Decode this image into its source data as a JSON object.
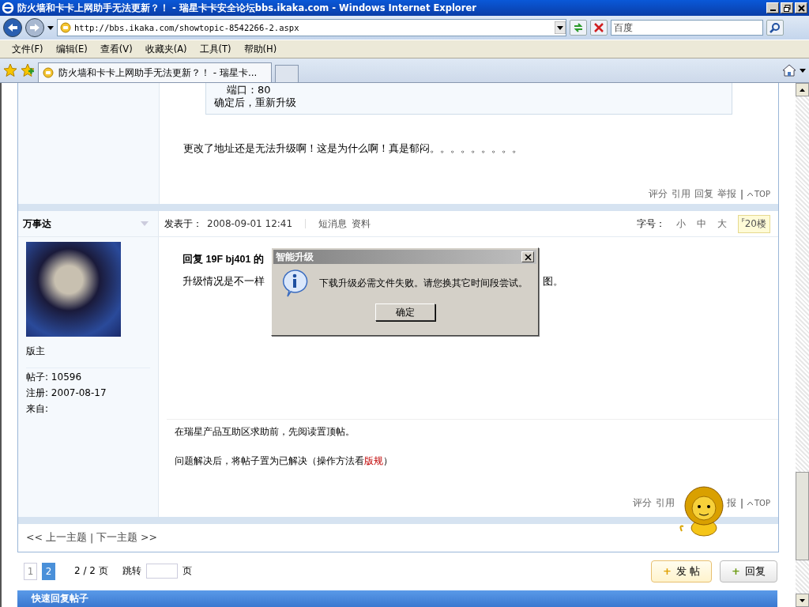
{
  "window": {
    "title": "防火墙和卡卡上网助手无法更新？！ - 瑞星卡卡安全论坛bbs.ikaka.com - Windows Internet Explorer"
  },
  "address_bar": {
    "url": "http://bbs.ikaka.com/showtopic-8542266-2.aspx",
    "search_placeholder": "百度"
  },
  "menu": [
    "文件(F)",
    "编辑(E)",
    "查看(V)",
    "收藏夹(A)",
    "工具(T)",
    "帮助(H)"
  ],
  "tabs": [
    {
      "label": "防火墙和卡卡上网助手无法更新？！ - 瑞星卡...",
      "selected": true
    }
  ],
  "previous_post": {
    "quote_lines": [
      "端口：80",
      "确定后，重新升级"
    ],
    "text": "更改了地址还是无法升级啊！这是为什么啊！真是郁闷。。。。。。。。。",
    "actions": [
      "评分",
      "引用",
      "回复",
      "举报"
    ],
    "separator": "|",
    "top": "TOP"
  },
  "post": {
    "author": "万事达",
    "posted_label": "发表于：",
    "posted_at": "2008-09-01 12:41",
    "links": [
      "短消息",
      "资料"
    ],
    "font_size_label": "字号：",
    "font_sizes": [
      "小",
      "中",
      "大"
    ],
    "floor_mark": "F",
    "floor": "20楼",
    "role": "版主",
    "stats": [
      "帖子: 10596",
      "注册: 2007-08-17",
      "来自:"
    ],
    "reply_heading": "回复  19F bj401 的",
    "body_start": "升级情况是不一样",
    "body_end": "图。",
    "signature_1": "在瑞星产品互助区求助前，先阅读置顶帖。",
    "signature_2": {
      "before": "问题解决后，将帖子置为已解决（操作方法看",
      "link": "版规",
      "after": "）"
    },
    "actions": [
      "评分",
      "引用"
    ],
    "actions_tail": "报",
    "separator": "|",
    "top": "TOP"
  },
  "nav": {
    "prev": "<< 上一主题",
    "separator": "|",
    "next": "下一主题 >>"
  },
  "pagination": {
    "pages": [
      {
        "label": "1",
        "selected": false
      },
      {
        "label": "2",
        "selected": true
      }
    ],
    "count": "2 / 2 页",
    "jump_label": "跳转",
    "jump_suffix": "页"
  },
  "buttons": [
    {
      "icon": "+",
      "label": "发 帖",
      "kind": "post"
    },
    {
      "icon": "+",
      "label": "回复",
      "kind": "reply"
    }
  ],
  "quick_reply": {
    "title": "快速回复帖子"
  },
  "dialog": {
    "title": "智能升级",
    "message": "下载升级必需文件失败。请您换其它时间段尝试。",
    "button": "确定"
  }
}
